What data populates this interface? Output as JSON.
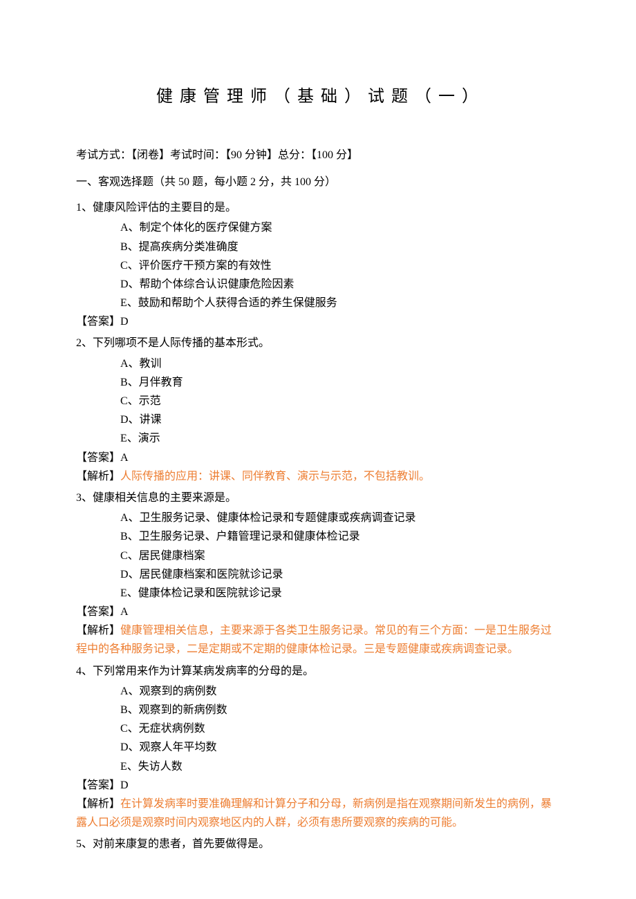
{
  "title": "健 康 管 理 师 （ 基 础 ） 试 题 （ 一 ）",
  "exam_meta": "考试方式：【闭卷】考试时间：【90 分钟】总分：【100 分】",
  "section_header": "一、客观选择题（共 50 题，每小题 2 分，共 100 分）",
  "questions": [
    {
      "stem": "1、健康风险评估的主要目的是。",
      "options": [
        "A、制定个体化的医疗保健方案",
        "B、提高疾病分类准确度",
        "C、评价医疗干预方案的有效性",
        "D、帮助个体综合认识健康危险因素",
        "E、鼓励和帮助个人获得合适的养生保健服务"
      ],
      "answer": "【答案】D",
      "analysis_label": "",
      "analysis_text": ""
    },
    {
      "stem": "2、下列哪项不是人际传播的基本形式。",
      "options": [
        "A、教训",
        "B、月伴教育",
        "C、示范",
        "D、讲课",
        "E、演示"
      ],
      "answer": "【答案】A",
      "analysis_label": "【解析】",
      "analysis_text": "人际传播的应用：讲课、同伴教育、演示与示范，不包括教训。"
    },
    {
      "stem": "3、健康相关信息的主要来源是。",
      "options": [
        "A、卫生服务记录、健康体检记录和专题健康或疾病调查记录",
        "B、卫生服务记录、户籍管理记录和健康体检记录",
        "C、居民健康档案",
        "D、居民健康档案和医院就诊记录",
        "E、健康体检记录和医院就诊记录"
      ],
      "answer": "【答案】A",
      "analysis_label": "【解析】",
      "analysis_text": "健康管理相关信息，主要来源于各类卫生服务记录。常见的有三个方面：一是卫生服务过程中的各种服务记录，二是定期或不定期的健康体检记录。三是专题健康或疾病调查记录。"
    },
    {
      "stem": "4、下列常用来作为计算某病发病率的分母的是。",
      "options": [
        "A、观察到的病例数",
        "B、观察到的新病例数",
        "C、无症状病例数",
        "D、观察人年平均数",
        "E、失访人数"
      ],
      "answer": "【答案】D",
      "analysis_label": "【解析】",
      "analysis_text": "在计算发病率时要准确理解和计算分子和分母，新病例是指在观察期间新发生的病例，暴露人口必须是观察时间内观察地区内的人群，必须有患所要观察的疾病的可能。"
    },
    {
      "stem": "5、对前来康复的患者，首先要做得是。",
      "options": [],
      "answer": "",
      "analysis_label": "",
      "analysis_text": ""
    }
  ]
}
